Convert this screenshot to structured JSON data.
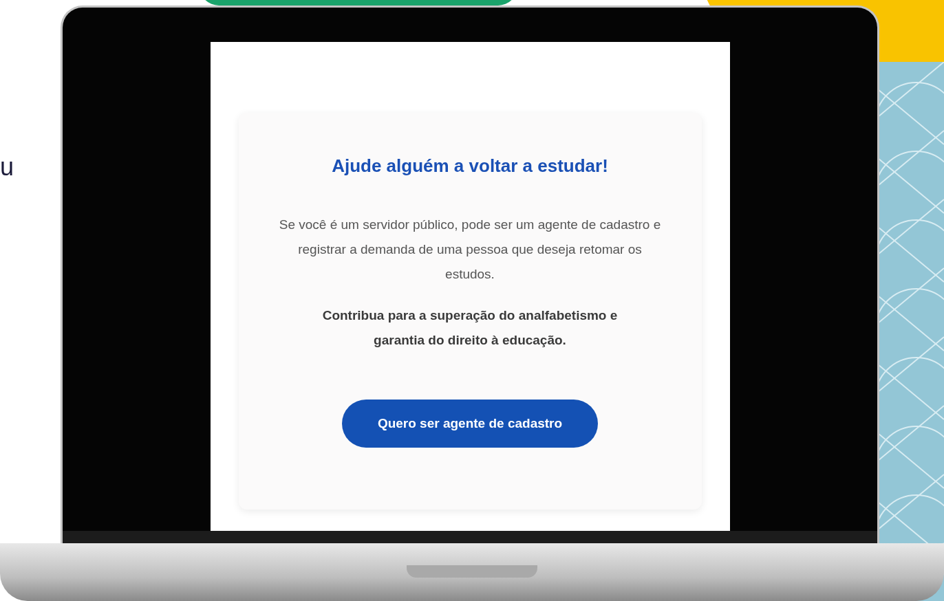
{
  "side_text": "u",
  "card": {
    "title": "Ajude alguém a voltar a estudar!",
    "body": "Se você é um servidor público, pode ser um agente de cadastro e registrar a demanda de uma pessoa que deseja retomar os estudos.",
    "emphasis": "Contribua para a superação do analfabetismo e garantia do direito à educação.",
    "button": "Quero ser agente de cadastro"
  }
}
